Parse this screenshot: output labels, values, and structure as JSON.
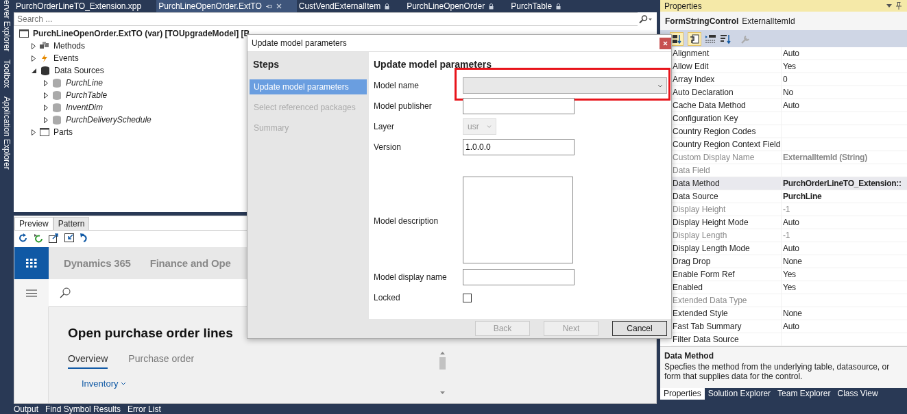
{
  "side_tabs": [
    "erver Explorer",
    "Toolbox",
    "Application Explorer"
  ],
  "doc_tabs": [
    {
      "label": "PurchOrderLineTO_Extension.xpp",
      "selected": false,
      "locked": false
    },
    {
      "label": "PurchLineOpenOrder.ExtTO",
      "selected": true,
      "locked": false
    },
    {
      "label": "CustVendExternalItem",
      "selected": false,
      "locked": true
    },
    {
      "label": "PurchLineOpenOrder",
      "selected": false,
      "locked": true
    },
    {
      "label": "PurchTable",
      "selected": false,
      "locked": true
    }
  ],
  "search": {
    "placeholder": "Search ..."
  },
  "tree": [
    {
      "label": "PurchLineOpenOrder.ExtTO (var) [TOUpgradeModel] [B",
      "kind": "form",
      "children": [
        {
          "label": "Methods",
          "kind": "methods",
          "expanded": false
        },
        {
          "label": "Events",
          "kind": "events",
          "expanded": false
        },
        {
          "label": "Data Sources",
          "kind": "datasources",
          "expanded": true,
          "children": [
            {
              "label": "PurchLine",
              "kind": "table",
              "expanded": false
            },
            {
              "label": "PurchTable",
              "kind": "table",
              "expanded": false
            },
            {
              "label": "InventDim",
              "kind": "table",
              "expanded": false
            },
            {
              "label": "PurchDeliverySchedule",
              "kind": "table",
              "expanded": false
            }
          ]
        },
        {
          "label": "Parts",
          "kind": "parts",
          "expanded": false
        }
      ]
    }
  ],
  "preview": {
    "tabs": [
      {
        "label": "Preview",
        "selected": true
      },
      {
        "label": "Pattern",
        "selected": false
      }
    ],
    "app_title": "Dynamics 365",
    "app_subtitle": "Finance and Ope",
    "page_title": "Open purchase order lines",
    "page_tabs": [
      {
        "label": "Overview",
        "selected": true
      },
      {
        "label": "Purchase order",
        "selected": false
      }
    ],
    "section": "Inventory"
  },
  "dialog": {
    "title": "Update model parameters",
    "steps_heading": "Steps",
    "steps": [
      {
        "label": "Update model parameters",
        "selected": true
      },
      {
        "label": "Select referenced packages",
        "selected": false
      },
      {
        "label": "Summary",
        "selected": false
      }
    ],
    "heading": "Update model parameters",
    "fields": [
      {
        "kind": "combo",
        "label": "Model name",
        "highlighted": true
      },
      {
        "kind": "text",
        "label": "Model publisher"
      },
      {
        "kind": "select",
        "label": "Layer",
        "value": "usr",
        "disabled": true
      },
      {
        "kind": "text",
        "label": "Version",
        "value": "1.0.0.0"
      },
      {
        "kind": "textarea",
        "label": "Model description"
      },
      {
        "kind": "text",
        "label": "Model display name"
      },
      {
        "kind": "checkbox",
        "label": "Locked",
        "checked": false
      }
    ],
    "buttons": [
      {
        "label": "Back",
        "disabled": true,
        "default": false
      },
      {
        "label": "Next",
        "disabled": true,
        "default": false
      },
      {
        "label": "Cancel",
        "disabled": false,
        "default": true
      }
    ]
  },
  "properties": {
    "title": "Properties",
    "object_type": "FormStringControl",
    "object_name": "ExternalItemId",
    "rows": [
      {
        "name": "Alignment",
        "value": "Auto",
        "disabled": false,
        "bold": false,
        "selected": false
      },
      {
        "name": "Allow Edit",
        "value": "Yes",
        "disabled": false,
        "bold": false,
        "selected": false
      },
      {
        "name": "Array Index",
        "value": "0",
        "disabled": false,
        "bold": false,
        "selected": false
      },
      {
        "name": "Auto Declaration",
        "value": "No",
        "disabled": false,
        "bold": false,
        "selected": false
      },
      {
        "name": "Cache Data Method",
        "value": "Auto",
        "disabled": false,
        "bold": false,
        "selected": false
      },
      {
        "name": "Configuration Key",
        "disabled": false,
        "selected": false
      },
      {
        "name": "Country Region Codes",
        "disabled": false,
        "selected": false
      },
      {
        "name": "Country Region Context Field",
        "disabled": false,
        "selected": false
      },
      {
        "name": "Custom Display Name",
        "value": "ExternalItemId (String)",
        "disabled": true,
        "bold": true,
        "selected": false
      },
      {
        "name": "Data Field",
        "disabled": true,
        "selected": false
      },
      {
        "name": "Data Method",
        "value": "PurchOrderLineTO_Extension::",
        "disabled": false,
        "bold": true,
        "selected": true
      },
      {
        "name": "Data Source",
        "value": "PurchLine",
        "disabled": false,
        "bold": true,
        "selected": false
      },
      {
        "name": "Display Height",
        "value": "-1",
        "disabled": true,
        "bold": false,
        "selected": false
      },
      {
        "name": "Display Height Mode",
        "value": "Auto",
        "disabled": false,
        "bold": false,
        "selected": false
      },
      {
        "name": "Display Length",
        "value": "-1",
        "disabled": true,
        "bold": false,
        "selected": false
      },
      {
        "name": "Display Length Mode",
        "value": "Auto",
        "disabled": false,
        "bold": false,
        "selected": false
      },
      {
        "name": "Drag Drop",
        "value": "None",
        "disabled": false,
        "bold": false,
        "selected": false
      },
      {
        "name": "Enable Form Ref",
        "value": "Yes",
        "disabled": false,
        "bold": false,
        "selected": false
      },
      {
        "name": "Enabled",
        "value": "Yes",
        "disabled": false,
        "bold": false,
        "selected": false
      },
      {
        "name": "Extended Data Type",
        "disabled": true,
        "selected": false
      },
      {
        "name": "Extended Style",
        "value": "None",
        "disabled": false,
        "bold": false,
        "selected": false
      },
      {
        "name": "Fast Tab Summary",
        "value": "Auto",
        "disabled": false,
        "bold": false,
        "selected": false
      },
      {
        "name": "Filter Data Source",
        "disabled": false,
        "selected": false
      }
    ],
    "description_title": "Data Method",
    "description": "Specfies the method from the underlying table, datasource, or form that supplies data for the control.",
    "tabs": [
      {
        "label": "Properties",
        "selected": true
      },
      {
        "label": "Solution Explorer",
        "selected": false
      },
      {
        "label": "Team Explorer",
        "selected": false
      },
      {
        "label": "Class View",
        "selected": false
      }
    ]
  },
  "bottom_tabs": [
    "Output",
    "Find Symbol Results",
    "Error List"
  ]
}
